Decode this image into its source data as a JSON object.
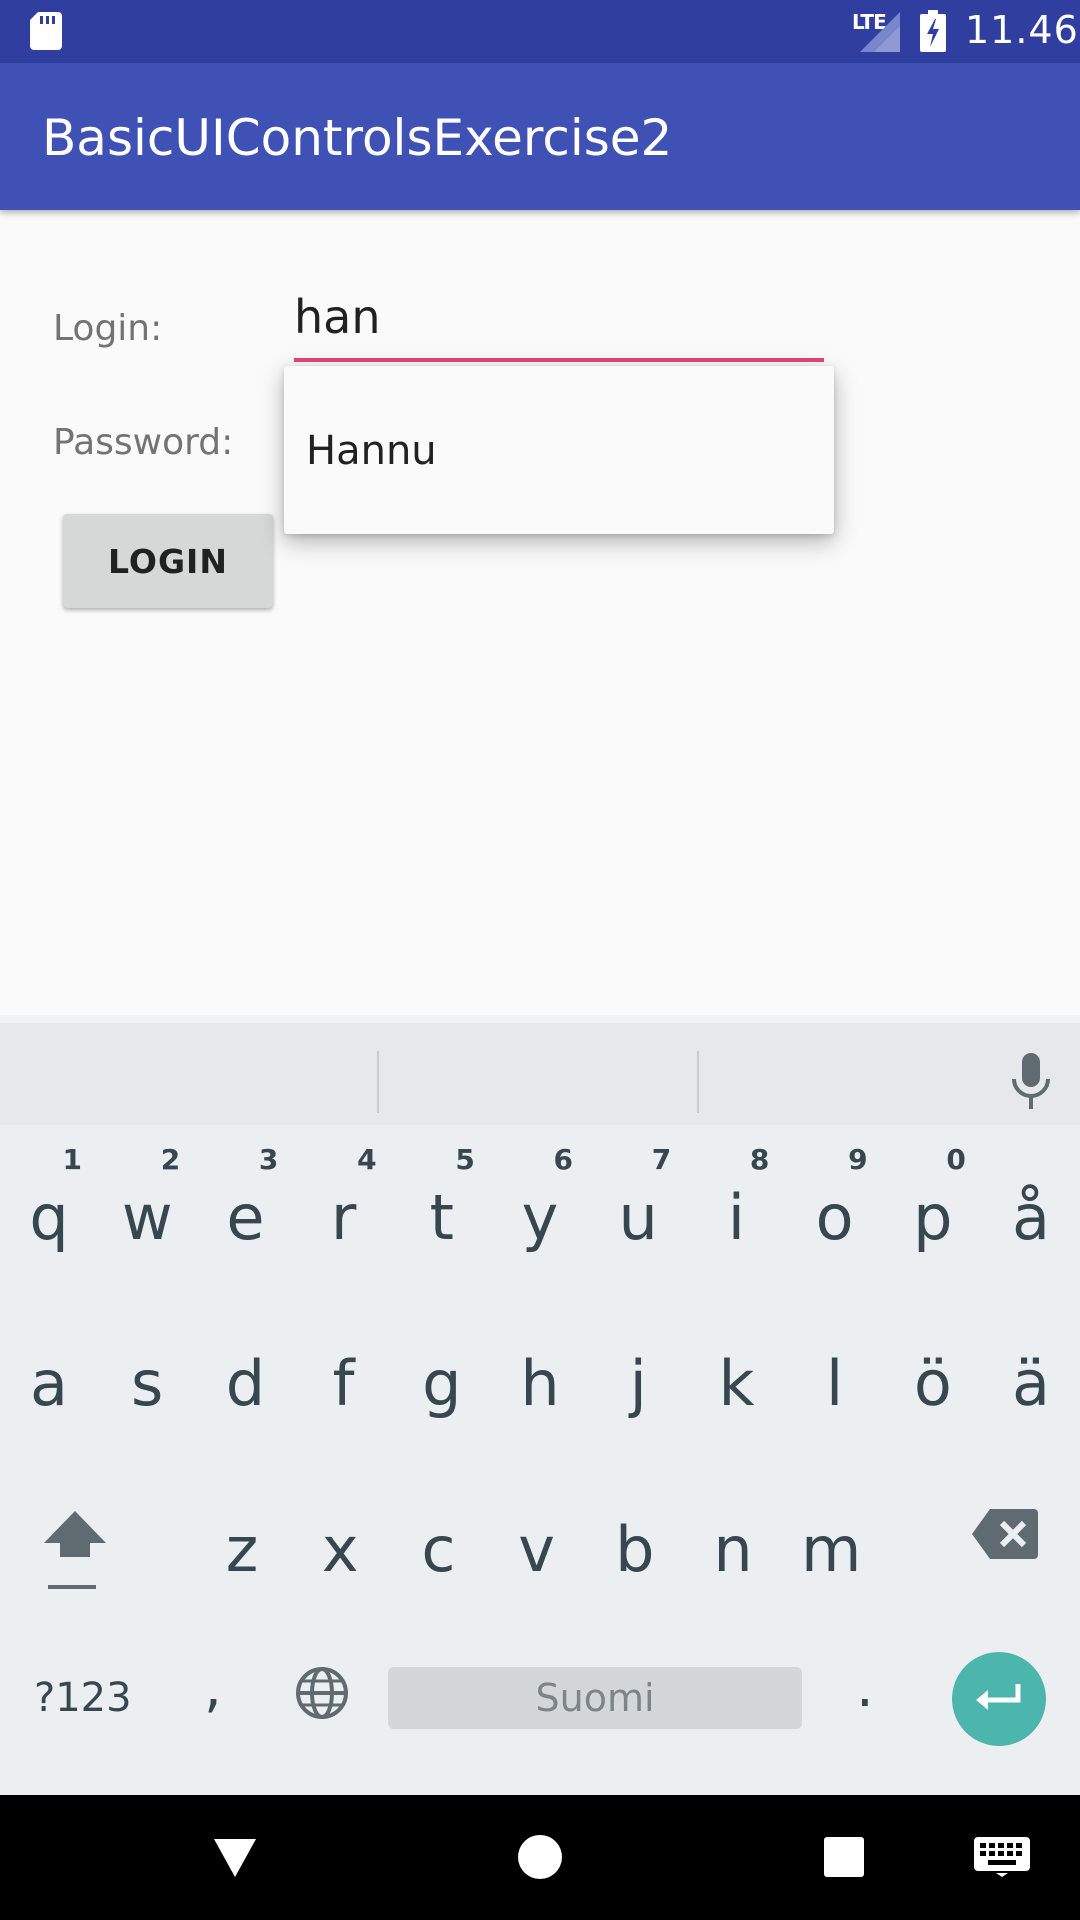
{
  "status_bar": {
    "network_label": "LTE",
    "time": "11.46",
    "icons": [
      "sd-card-icon",
      "signal-icon",
      "battery-charging-icon"
    ]
  },
  "app_bar": {
    "title": "BasicUIControlsExercise2",
    "color": "#3f51b5"
  },
  "form": {
    "login_label": "Login:",
    "login_value": "han",
    "password_label": "Password:",
    "login_button": "LOGIN",
    "accent_color": "#e0457b"
  },
  "autocomplete": {
    "items": [
      "Hannu"
    ]
  },
  "keyboard": {
    "row1": [
      {
        "letter": "q",
        "num": "1"
      },
      {
        "letter": "w",
        "num": "2"
      },
      {
        "letter": "e",
        "num": "3"
      },
      {
        "letter": "r",
        "num": "4"
      },
      {
        "letter": "t",
        "num": "5"
      },
      {
        "letter": "y",
        "num": "6"
      },
      {
        "letter": "u",
        "num": "7"
      },
      {
        "letter": "i",
        "num": "8"
      },
      {
        "letter": "o",
        "num": "9"
      },
      {
        "letter": "p",
        "num": "0"
      },
      {
        "letter": "å",
        "num": ""
      }
    ],
    "row2": [
      "a",
      "s",
      "d",
      "f",
      "g",
      "h",
      "j",
      "k",
      "l",
      "ö",
      "ä"
    ],
    "row3": [
      "z",
      "x",
      "c",
      "v",
      "b",
      "n",
      "m"
    ],
    "symbols_key": "?123",
    "comma_key": ",",
    "space_label": "Suomi",
    "period_key": ".",
    "enter_color": "#4db6ac"
  }
}
